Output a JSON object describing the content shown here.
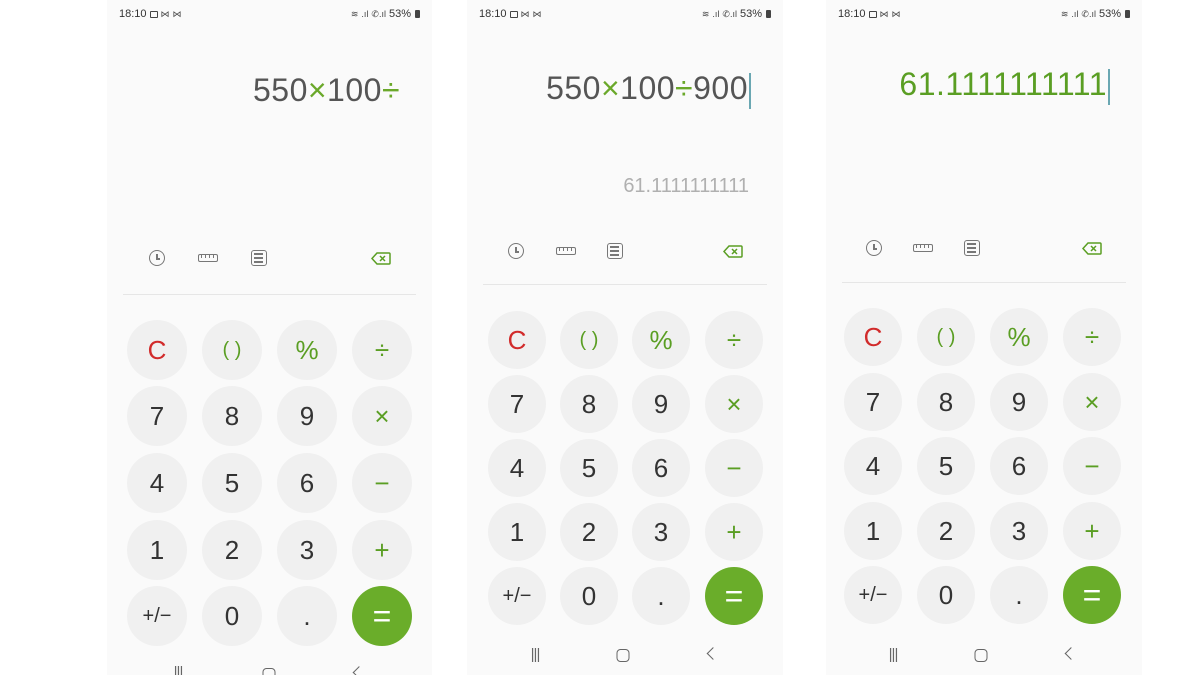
{
  "screens": [
    {
      "status": {
        "time": "18:10",
        "battery": "53%"
      },
      "display": {
        "parts": [
          "550",
          "×",
          "100",
          "÷"
        ],
        "preview": ""
      },
      "keys": {
        "row1": [
          "C",
          "( )",
          "%",
          "÷"
        ],
        "row2": [
          "7",
          "8",
          "9",
          "×"
        ],
        "row3": [
          "4",
          "5",
          "6",
          "−"
        ],
        "row4": [
          "1",
          "2",
          "3",
          "+"
        ],
        "row5": [
          "+/−",
          "0",
          ".",
          "="
        ]
      }
    },
    {
      "status": {
        "time": "18:10",
        "battery": "53%"
      },
      "display": {
        "parts": [
          "550",
          "×",
          "100",
          "÷",
          "900"
        ],
        "preview": "61.1111111111"
      },
      "keys": {
        "row1": [
          "C",
          "( )",
          "%",
          "÷"
        ],
        "row2": [
          "7",
          "8",
          "9",
          "×"
        ],
        "row3": [
          "4",
          "5",
          "6",
          "−"
        ],
        "row4": [
          "1",
          "2",
          "3",
          "+"
        ],
        "row5": [
          "+/−",
          "0",
          ".",
          "="
        ]
      }
    },
    {
      "status": {
        "time": "18:10",
        "battery": "53%"
      },
      "display": {
        "result": "61.1111111111"
      },
      "keys": {
        "row1": [
          "C",
          "( )",
          "%",
          "÷"
        ],
        "row2": [
          "7",
          "8",
          "9",
          "×"
        ],
        "row3": [
          "4",
          "5",
          "6",
          "−"
        ],
        "row4": [
          "1",
          "2",
          "3",
          "+"
        ],
        "row5": [
          "+/−",
          "0",
          ".",
          "="
        ]
      }
    }
  ],
  "colors": {
    "accent": "#6aad2a",
    "clear": "#d12b2b",
    "key_bg": "#f0f0f0",
    "screen_bg": "#fafafa"
  },
  "icons": [
    "history-icon",
    "unit-converter-icon",
    "scientific-mode-icon",
    "backspace-icon",
    "wifi-icon",
    "signal-icon",
    "battery-icon"
  ]
}
